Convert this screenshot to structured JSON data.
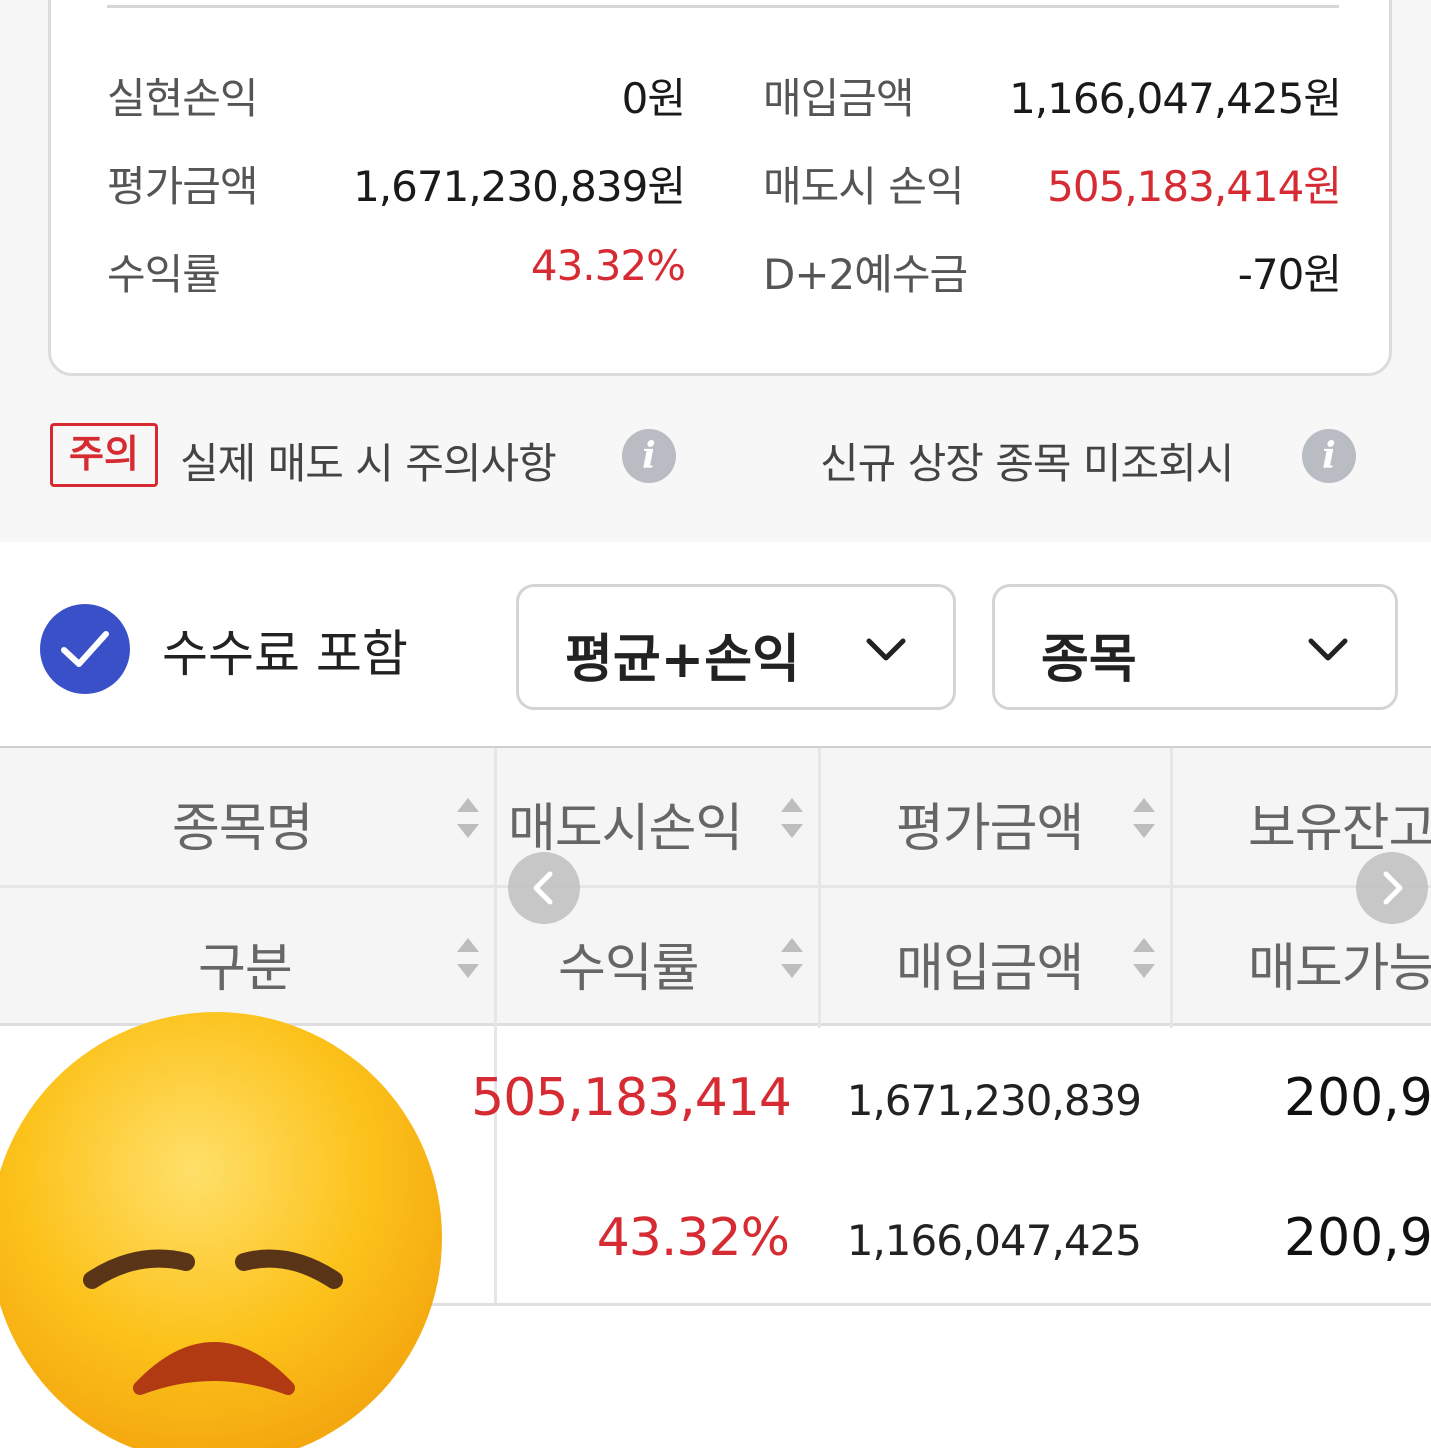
{
  "summary": {
    "realized_pl_label": "실현손익",
    "realized_pl_value": "0원",
    "purchase_amount_label": "매입금액",
    "purchase_amount_value": "1,166,047,425원",
    "valuation_label": "평가금액",
    "valuation_value": "1,671,230,839원",
    "sell_pl_label": "매도시 손익",
    "sell_pl_value": "505,183,414원",
    "return_rate_label": "수익률",
    "return_rate_value": "43.32%",
    "d2_deposit_label": "D+2예수금",
    "d2_deposit_value": "-70원"
  },
  "notices": {
    "caution_badge": "주의",
    "sell_caution_text": "실제 매도 시 주의사항",
    "new_listing_text": "신규 상장 종목 미조회시",
    "info_icon_glyph": "i"
  },
  "filters": {
    "include_fee_label": "수수료 포함",
    "include_fee_checked": true,
    "view_mode_selected": "평균+손익",
    "group_by_selected": "종목"
  },
  "table": {
    "headers_row1": [
      "종목명",
      "매도시손익",
      "평가금액",
      "보유잔고"
    ],
    "headers_row2": [
      "구분",
      "수익률",
      "매입금액",
      "매도가능"
    ],
    "rows": [
      {
        "sell_pl": "505,183,414",
        "return_rate": "43.32%",
        "valuation": "1,671,230,839",
        "purchase": "1,166,047,425",
        "holding": "200,9",
        "sellable": "200,9"
      }
    ]
  },
  "colors": {
    "accent_red": "#d62b33",
    "check_blue": "#3a50c8",
    "emoji_yellow": "#fcc21b"
  },
  "icons": [
    "check-icon",
    "chevron-down-icon",
    "info-icon",
    "sort-icon",
    "arrow-left-icon",
    "arrow-right-icon",
    "disappointed-face-emoji"
  ]
}
